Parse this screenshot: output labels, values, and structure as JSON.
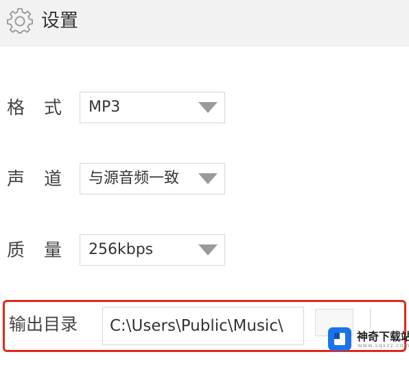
{
  "header": {
    "title": "设置",
    "icon": "gear-icon"
  },
  "settings": {
    "format": {
      "label_1": "格",
      "label_2": "式",
      "value": "MP3"
    },
    "channel": {
      "label_1": "声",
      "label_2": "道",
      "value": "与源音频一致"
    },
    "quality": {
      "label_1": "质",
      "label_2": "量",
      "value": "256kbps"
    },
    "output": {
      "label": "输出目录",
      "path": "C:\\Users\\Public\\Music\\"
    }
  },
  "watermark": {
    "name": "神奇下载站",
    "url": "www.sqxzz.com"
  },
  "colors": {
    "highlight_border": "#e0261b",
    "header_bg": "#f2f2f2",
    "logo_blue": "#1a73e8"
  }
}
